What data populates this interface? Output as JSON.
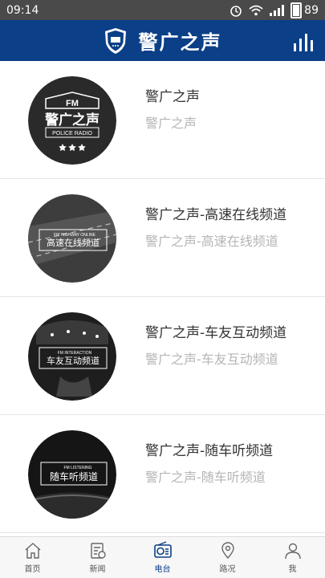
{
  "status_bar": {
    "time": "09:14",
    "battery": "89"
  },
  "header": {
    "title": "警广之声"
  },
  "channels": [
    {
      "title": "警广之声",
      "subtitle": "警广之声",
      "thumb_line1": "FM",
      "thumb_line2": "警广之声",
      "thumb_line3": "POLICE RADIO"
    },
    {
      "title": "警广之声-高速在线频道",
      "subtitle": "警广之声-高速在线频道",
      "thumb_caption_small": "FM HIGHWAY ONLINE",
      "thumb_caption": "高速在线频道"
    },
    {
      "title": "警广之声-车友互动频道",
      "subtitle": "警广之声-车友互动频道",
      "thumb_caption_small": "FM INTERACTION",
      "thumb_caption": "车友互动频道"
    },
    {
      "title": "警广之声-随车听频道",
      "subtitle": "警广之声-随车听频道",
      "thumb_caption_small": "FM LISTENING",
      "thumb_caption": "随车听频道"
    }
  ],
  "bottom_nav": [
    {
      "label": "首页",
      "icon": "home-icon"
    },
    {
      "label": "新闻",
      "icon": "news-icon"
    },
    {
      "label": "电台",
      "icon": "radio-icon",
      "active": true
    },
    {
      "label": "路况",
      "icon": "traffic-icon"
    },
    {
      "label": "我",
      "icon": "profile-icon"
    }
  ],
  "colors": {
    "header_bg": "#0b3f87",
    "status_bg": "#4a4a4a",
    "active_tab": "#0b3f87"
  }
}
